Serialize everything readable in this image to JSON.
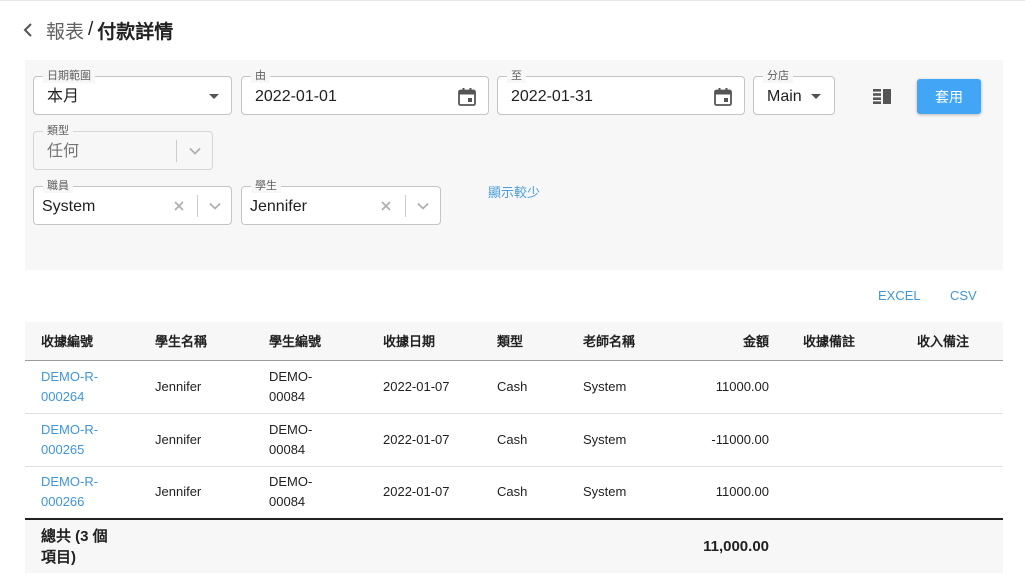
{
  "breadcrumb": {
    "root": "報表",
    "separator": "/",
    "current": "付款詳情"
  },
  "filters": {
    "date_range": {
      "label": "日期範圍",
      "value": "本月"
    },
    "from": {
      "label": "由",
      "value": "2022-01-01"
    },
    "to": {
      "label": "至",
      "value": "2022-01-31"
    },
    "branch": {
      "label": "分店",
      "value": "Main"
    },
    "type": {
      "label": "類型",
      "value": "任何"
    },
    "staff": {
      "label": "職員",
      "value": "System"
    },
    "student": {
      "label": "學生",
      "value": "Jennifer"
    },
    "apply_label": "套用",
    "show_less_label": "顯示較少"
  },
  "exports": {
    "excel_label": "EXCEL",
    "csv_label": "CSV"
  },
  "table": {
    "headers": {
      "receipt_no": "收據編號",
      "student_name": "學生名稱",
      "student_no": "學生編號",
      "receipt_date": "收據日期",
      "type": "類型",
      "teacher_name": "老師名稱",
      "amount": "金額",
      "receipt_note": "收據備註",
      "income_note": "收入備注"
    },
    "rows": [
      {
        "receipt_no_1": "DEMO-R-",
        "receipt_no_2": "000264",
        "student_name": "Jennifer",
        "student_no_1": "DEMO-",
        "student_no_2": "00084",
        "receipt_date": "2022-01-07",
        "type": "Cash",
        "teacher_name": "System",
        "amount": "11000.00",
        "receipt_note": "",
        "income_note": ""
      },
      {
        "receipt_no_1": "DEMO-R-",
        "receipt_no_2": "000265",
        "student_name": "Jennifer",
        "student_no_1": "DEMO-",
        "student_no_2": "00084",
        "receipt_date": "2022-01-07",
        "type": "Cash",
        "teacher_name": "System",
        "amount": "-11000.00",
        "receipt_note": "",
        "income_note": ""
      },
      {
        "receipt_no_1": "DEMO-R-",
        "receipt_no_2": "000266",
        "student_name": "Jennifer",
        "student_no_1": "DEMO-",
        "student_no_2": "00084",
        "receipt_date": "2022-01-07",
        "type": "Cash",
        "teacher_name": "System",
        "amount": "11000.00",
        "receipt_note": "",
        "income_note": ""
      }
    ],
    "total": {
      "label_line1": "總共 (3 個",
      "label_line2": "項目)",
      "amount": "11,000.00"
    }
  },
  "icons": {
    "back": "chevron-left-icon",
    "calendar": "calendar-icon",
    "columns": "view-columns-icon",
    "clear": "close-icon",
    "dropdown": "chevron-down-icon"
  },
  "colors": {
    "accent": "#42a5f5",
    "link": "#3f96d9",
    "panel": "#f7f7f7"
  }
}
